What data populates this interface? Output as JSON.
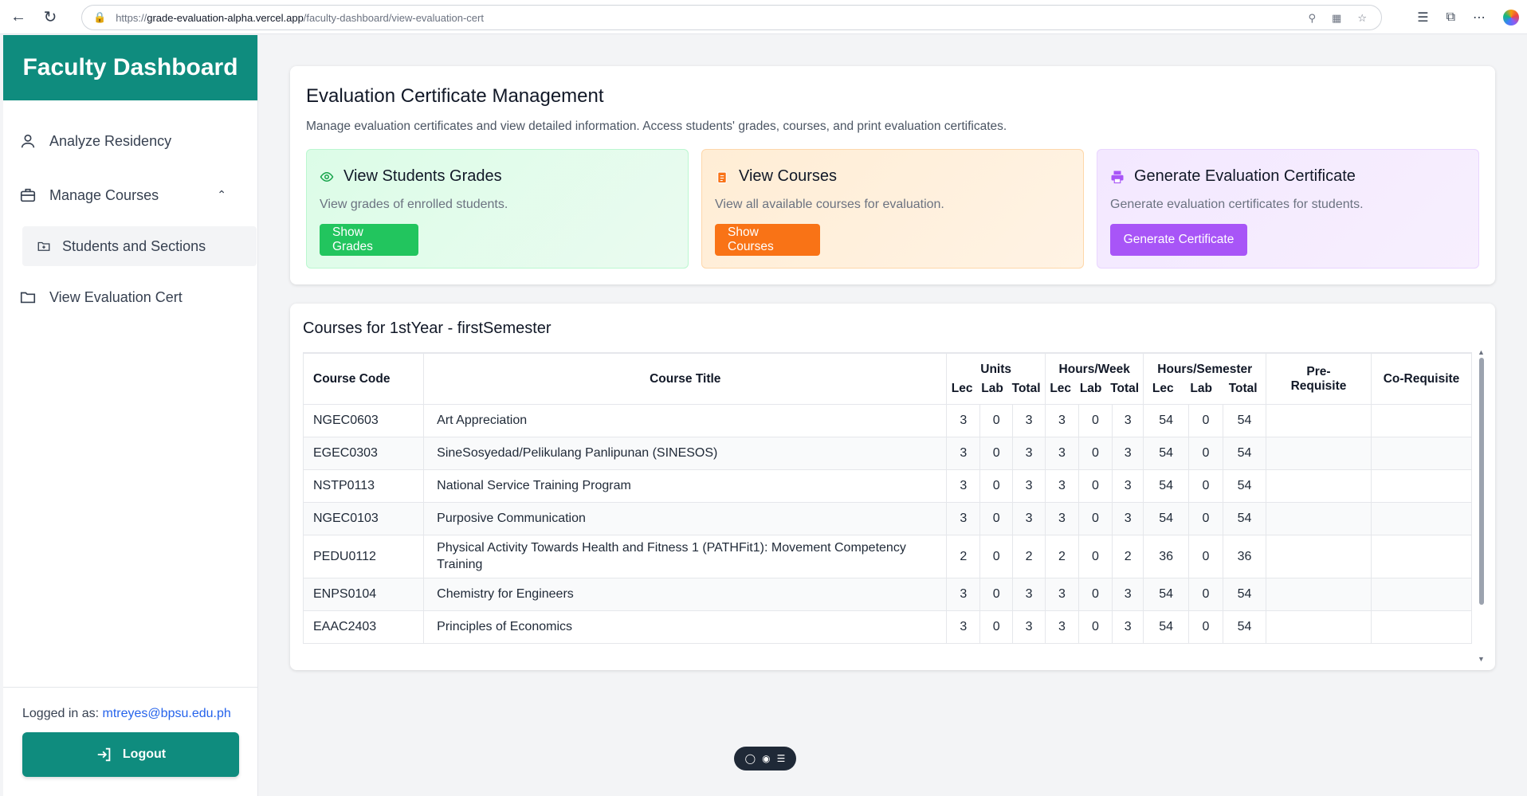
{
  "browser": {
    "url_prefix": "https://",
    "url_host": "grade-evaluation-alpha.vercel.app",
    "url_path": "/faculty-dashboard/view-evaluation-cert"
  },
  "sidebar": {
    "title": "Faculty Dashboard",
    "items": [
      {
        "label": "Analyze Residency",
        "icon": "user-icon"
      },
      {
        "label": "Manage Courses",
        "icon": "briefcase-icon"
      },
      {
        "label": "Students and Sections",
        "icon": "folder-plus-icon"
      },
      {
        "label": "View Evaluation Cert",
        "icon": "folder-icon"
      }
    ],
    "logged_label": "Logged in as:",
    "logged_email": "mtreyes@bpsu.edu.ph",
    "logout_label": "Logout"
  },
  "main": {
    "title": "Evaluation Certificate Management",
    "description": "Manage evaluation certificates and view detailed information. Access students' grades, courses, and print evaluation certificates.",
    "features": [
      {
        "title": "View Students Grades",
        "desc": "View grades of enrolled students.",
        "button": "Show Grades",
        "icon": "eye-icon",
        "color": "#22c55e"
      },
      {
        "title": "View Courses",
        "desc": "View all available courses for evaluation.",
        "button": "Show Courses",
        "icon": "clipboard-icon",
        "color": "#f97316"
      },
      {
        "title": "Generate Evaluation Certificate",
        "desc": "Generate evaluation certificates for students.",
        "button": "Generate Certificate",
        "icon": "printer-icon",
        "color": "#a855f7"
      }
    ],
    "table_title": "Courses for 1stYear - firstSemester",
    "headers": {
      "code": "Course Code",
      "title": "Course Title",
      "units": "Units",
      "hours_week": "Hours/Week",
      "hours_sem": "Hours/Semester",
      "prereq": "Pre-Requisite",
      "coreq": "Co-Requisite",
      "lec": "Lec",
      "lab": "Lab",
      "total": "Total"
    },
    "rows": [
      {
        "code": "NGEC0603",
        "title": "Art Appreciation",
        "v": [
          "3",
          "0",
          "3",
          "3",
          "0",
          "3",
          "54",
          "0",
          "54"
        ]
      },
      {
        "code": "EGEC0303",
        "title": "SineSosyedad/Pelikulang Panlipunan (SINESOS)",
        "v": [
          "3",
          "0",
          "3",
          "3",
          "0",
          "3",
          "54",
          "0",
          "54"
        ]
      },
      {
        "code": "NSTP0113",
        "title": "National Service Training Program",
        "v": [
          "3",
          "0",
          "3",
          "3",
          "0",
          "3",
          "54",
          "0",
          "54"
        ]
      },
      {
        "code": "NGEC0103",
        "title": "Purposive Communication",
        "v": [
          "3",
          "0",
          "3",
          "3",
          "0",
          "3",
          "54",
          "0",
          "54"
        ]
      },
      {
        "code": "PEDU0112",
        "title": "Physical Activity Towards Health and Fitness 1 (PATHFit1): Movement Competency Training",
        "v": [
          "2",
          "0",
          "2",
          "2",
          "0",
          "2",
          "36",
          "0",
          "36"
        ]
      },
      {
        "code": "ENPS0104",
        "title": "Chemistry for Engineers",
        "v": [
          "3",
          "0",
          "3",
          "3",
          "0",
          "3",
          "54",
          "0",
          "54"
        ]
      },
      {
        "code": "EAAC2403",
        "title": "Principles of Economics",
        "v": [
          "3",
          "0",
          "3",
          "3",
          "0",
          "3",
          "54",
          "0",
          "54"
        ]
      }
    ]
  },
  "colors": {
    "brand": "#0f8c7e"
  }
}
